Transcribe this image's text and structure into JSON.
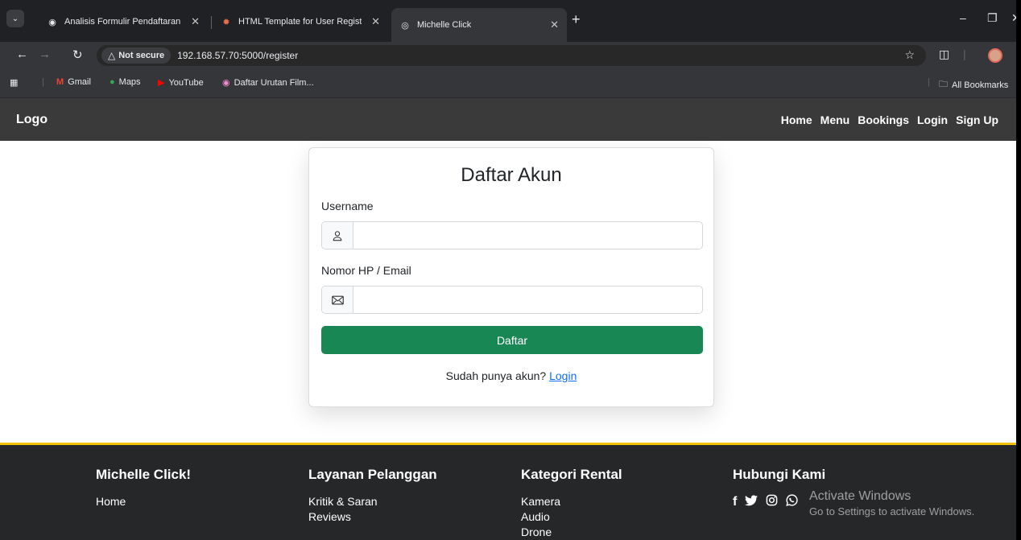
{
  "browser": {
    "tabs": [
      {
        "title": "Analisis Formulir Pendaftaran"
      },
      {
        "title": "HTML Template for User Regist"
      },
      {
        "title": "Michelle Click"
      }
    ],
    "not_secure": "Not secure",
    "url": "192.168.57.70:5000/register",
    "bookmarks": [
      "Gmail",
      "Maps",
      "YouTube",
      "Daftar Urutan Film..."
    ],
    "all_bookmarks": "All Bookmarks"
  },
  "site_nav": {
    "logo": "Logo",
    "links": [
      "Home",
      "Menu",
      "Bookings",
      "Login",
      "Sign Up"
    ]
  },
  "form": {
    "title": "Daftar Akun",
    "username_label": "Username",
    "username_value": "",
    "contact_label": "Nomor HP / Email",
    "contact_value": "",
    "submit_label": "Daftar",
    "login_prompt": "Sudah punya akun?",
    "login_link": "Login"
  },
  "footer": {
    "columns": [
      {
        "title": "Michelle Click!",
        "items": [
          "Home"
        ]
      },
      {
        "title": "Layanan Pelanggan",
        "items": [
          "Kritik & Saran",
          "Reviews"
        ]
      },
      {
        "title": "Kategori Rental",
        "items": [
          "Kamera",
          "Audio",
          "Drone"
        ]
      },
      {
        "title": "Hubungi Kami",
        "social": [
          "facebook-icon",
          "twitter-icon",
          "instagram-icon",
          "whatsapp-icon"
        ]
      }
    ]
  },
  "watermark": {
    "line1": "Activate Windows",
    "line2": "Go to Settings to activate Windows."
  },
  "colors": {
    "primary_button": "#198754",
    "link": "#0d6efd",
    "footer_accent": "#f2c200",
    "navbar": "#3a3a3a",
    "footer_bg": "#252729"
  }
}
